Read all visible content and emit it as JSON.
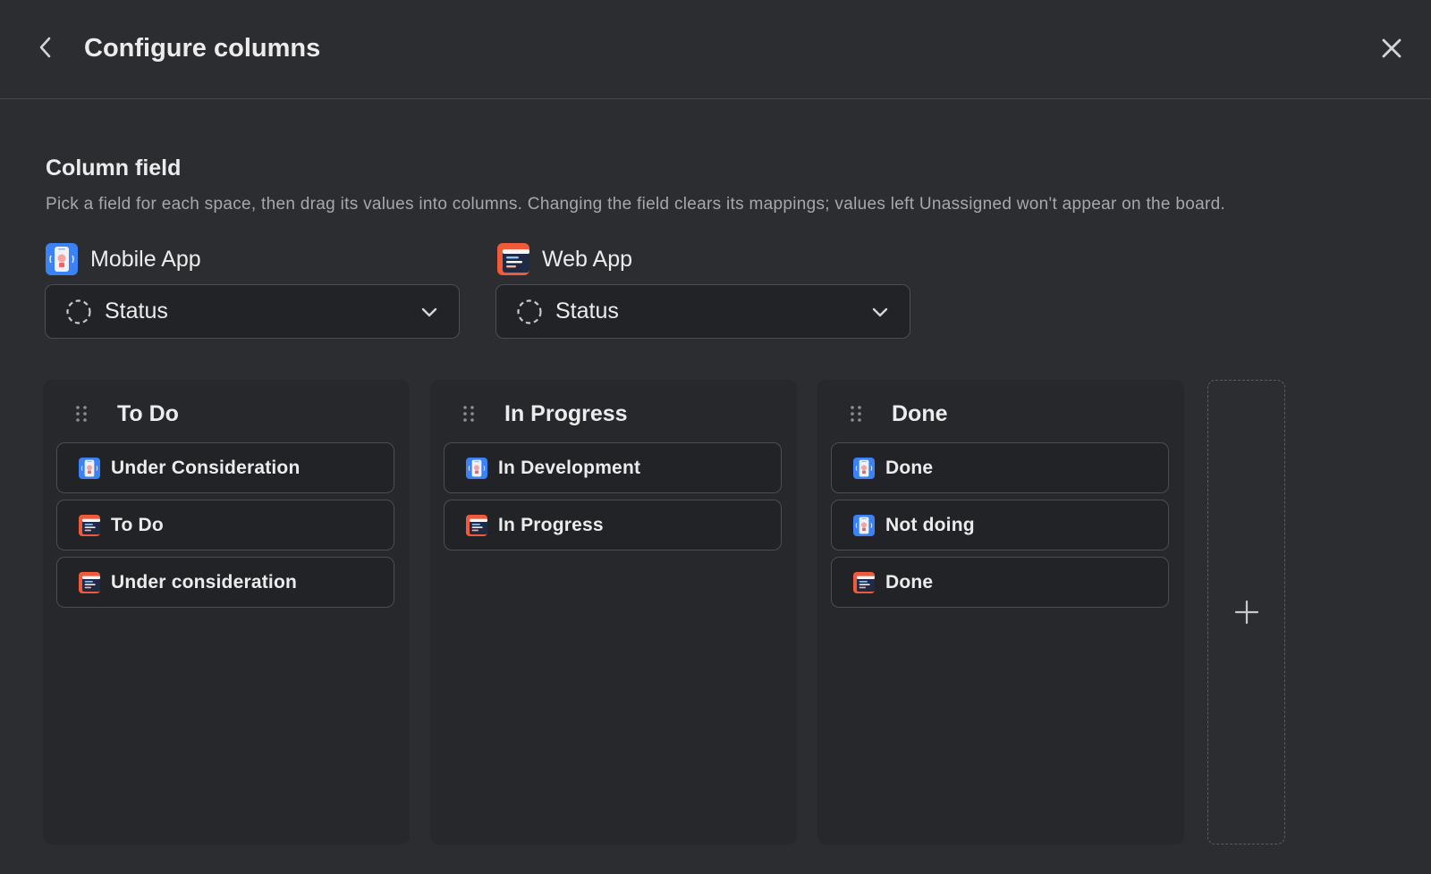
{
  "header": {
    "title": "Configure columns"
  },
  "section": {
    "title": "Column field",
    "description": "Pick a field for each space, then drag its values into columns. Changing the field clears its mappings; values left Unassigned won't appear on the board."
  },
  "spaces": [
    {
      "name": "Mobile App",
      "icon": "mobile-app-icon",
      "field": "Status"
    },
    {
      "name": "Web App",
      "icon": "web-app-icon",
      "field": "Status"
    }
  ],
  "columns": [
    {
      "title": "To Do",
      "cards": [
        {
          "label": "Under Consideration",
          "space": "Mobile App"
        },
        {
          "label": "To Do",
          "space": "Web App"
        },
        {
          "label": "Under consideration",
          "space": "Web App"
        }
      ]
    },
    {
      "title": "In Progress",
      "cards": [
        {
          "label": "In Development",
          "space": "Mobile App"
        },
        {
          "label": "In Progress",
          "space": "Web App"
        }
      ]
    },
    {
      "title": "Done",
      "cards": [
        {
          "label": "Done",
          "space": "Mobile App"
        },
        {
          "label": "Not doing",
          "space": "Mobile App"
        },
        {
          "label": "Done",
          "space": "Web App"
        }
      ]
    }
  ],
  "colors": {
    "background": "#2c2d30",
    "column_background": "#27282b",
    "mobile_icon": "#3b82f6",
    "web_icon": "#f05a38"
  }
}
